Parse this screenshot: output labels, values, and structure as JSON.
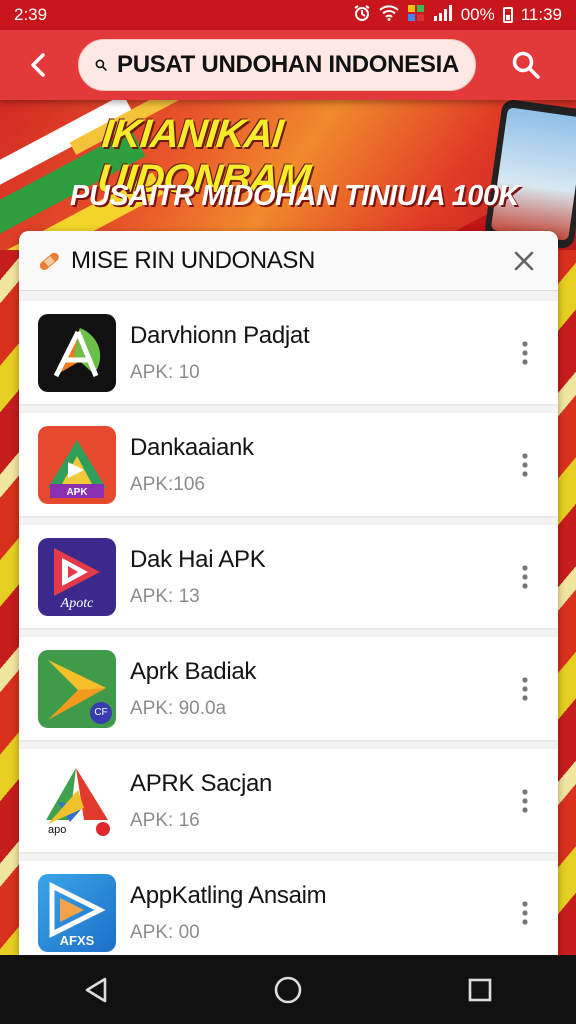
{
  "status_bar": {
    "time_left": "2:39",
    "battery": "00%",
    "time_right": "11:39",
    "icons": [
      "alarm-icon",
      "wifi-icon",
      "app-notification-icon",
      "signal-icon",
      "battery-icon"
    ]
  },
  "app_bar": {
    "back_icon": "chevron-left-icon",
    "search_text": "PUSAT UNDOHAN INDONESIA",
    "search_icon": "search-icon"
  },
  "banner": {
    "title": "IKIANIKAI UIDONBAM",
    "subtitle": "PUSAITR MIDOHAN TINIUIA 100K"
  },
  "panel": {
    "title": "MISE RIN UNDONASN",
    "title_icon": "bandage-icon",
    "close_icon": "close-icon"
  },
  "apps": [
    {
      "name": "Darvhionn Padjat",
      "meta": "APK: 10",
      "icon": "orange-green-a-app-icon"
    },
    {
      "name": "Dankaaiank",
      "meta": "APK:106",
      "icon": "red-colorful-arrow-app-icon"
    },
    {
      "name": "Dak Hai APK",
      "meta": "APK: 13",
      "icon": "purple-play-arrow-app-icon",
      "icon_text": "Apotc"
    },
    {
      "name": "Aprk Badiak",
      "meta": "APK: 90.0a",
      "icon": "green-play-arrow-app-icon",
      "icon_text": "CF"
    },
    {
      "name": "APRK Sacjan",
      "meta": "APK: 16",
      "icon": "multicolor-triangle-app-icon",
      "icon_text": "apo"
    },
    {
      "name": "AppKatling Ansaim",
      "meta": "APK: 00",
      "icon": "blue-play-arrow-app-icon",
      "icon_text": "AFXS"
    }
  ],
  "nav_bar": {
    "icons": [
      "back-triangle-icon",
      "home-circle-icon",
      "recents-square-icon"
    ]
  },
  "colors": {
    "status_bar": "#c8161c",
    "app_bar": "#e23a3a",
    "search_pill": "#fde8e4",
    "banner_title": "#f7ec2a"
  }
}
